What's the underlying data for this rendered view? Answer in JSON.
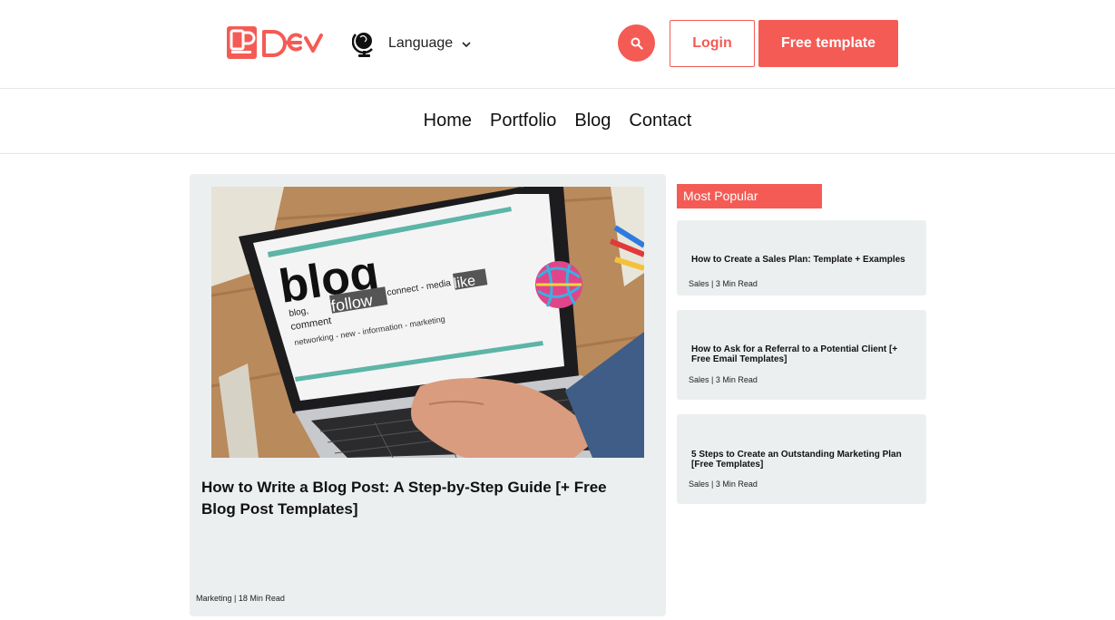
{
  "header": {
    "logo_text": "PDev",
    "language_label": "Language",
    "login_label": "Login",
    "free_template_label": "Free template",
    "colors": {
      "accent": "#f45b55",
      "card_bg": "#ecefef"
    }
  },
  "nav": {
    "items": [
      {
        "label": "Home"
      },
      {
        "label": "Portfolio"
      },
      {
        "label": "Blog"
      },
      {
        "label": "Contact"
      }
    ]
  },
  "featured": {
    "image_text": [
      "blog",
      "blog,",
      "follow",
      "comment",
      "connect - media",
      "like",
      "networking - new - information - marketing"
    ],
    "title": "How to Write a Blog Post: A Step-by-Step Guide [+ Free Blog Post Templates]",
    "meta": "Marketing | 18 Min Read"
  },
  "sidebar": {
    "heading": "Most Popular",
    "posts": [
      {
        "title": "How to Create a Sales Plan: Template + Examples",
        "meta": "Sales | 3 Min Read"
      },
      {
        "title": "How to Ask for a Referral to a Potential Client [+ Free Email Templates]",
        "meta": "Sales | 3 Min Read"
      },
      {
        "title": "5 Steps to Create an Outstanding Marketing Plan [Free Templates]",
        "meta": "Sales | 3 Min Read"
      }
    ]
  }
}
